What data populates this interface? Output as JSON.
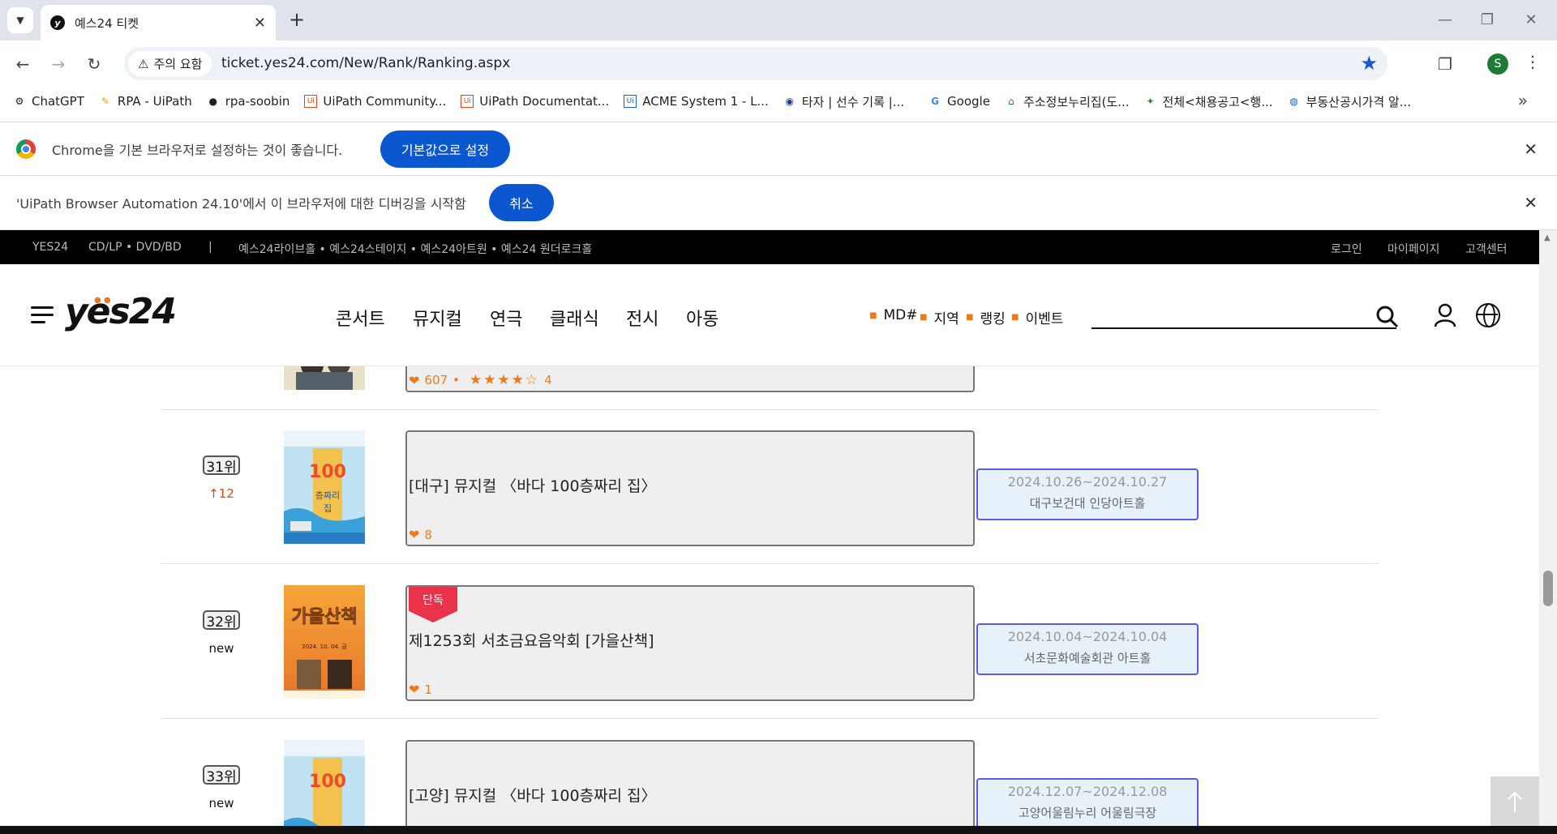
{
  "browser": {
    "tab_title": "예스24 티켓",
    "tab_favicon": "y",
    "security_chip": "주의 요함",
    "url": "ticket.yes24.com/New/Rank/Ranking.aspx",
    "profile_initial": "S",
    "bookmarks": [
      {
        "label": "ChatGPT",
        "icon": "chatgpt-icon"
      },
      {
        "label": "RPA - UiPath",
        "icon": "pencil-icon"
      },
      {
        "label": "rpa-soobin",
        "icon": "github-icon"
      },
      {
        "label": "UiPath Community...",
        "icon": "uipath-icon"
      },
      {
        "label": "UiPath Documentat...",
        "icon": "uipath-icon"
      },
      {
        "label": "ACME System 1 - L...",
        "icon": "ui-icon"
      },
      {
        "label": "타자 | 선수 기록 |...",
        "icon": "baseball-icon"
      },
      {
        "label": "Google",
        "icon": "google-icon"
      },
      {
        "label": "주소정보누리집(도...",
        "icon": "home-icon"
      },
      {
        "label": "전체<채용공고<행...",
        "icon": "bird-icon"
      },
      {
        "label": "부동산공시가격 알...",
        "icon": "globe-icon"
      }
    ],
    "infobar_default": {
      "message": "Chrome을 기본 브라우저로 설정하는 것이 좋습니다.",
      "button": "기본값으로 설정"
    },
    "infobar_debug": {
      "message": "'UiPath Browser Automation 24.10'에서 이 브라우저에 대한 디버깅을 시작함",
      "button": "취소"
    }
  },
  "site": {
    "topbar": {
      "left": [
        "YES24",
        "CD/LP • DVD/BD",
        "|",
        "예스24라이브홀 • 예스24스테이지 • 예스24아트원 • 예스24 원더로크홀"
      ],
      "right": [
        "로그인",
        "마이페이지",
        "고객센터"
      ]
    },
    "logo": "yes24",
    "main_nav": [
      "콘서트",
      "뮤지컬",
      "연극",
      "클래식",
      "전시",
      "아동"
    ],
    "sub_nav": [
      "MD#",
      "지역",
      "랭킹",
      "이벤트"
    ],
    "search_placeholder": ""
  },
  "rankings": [
    {
      "likes": "607",
      "rating": "4",
      "stars_filled": 4
    },
    {
      "rank": "31위",
      "change": "↑12",
      "title": "[대구] 뮤지컬 〈바다 100층짜리 집〉",
      "likes": "8",
      "dates": "2024.10.26~2024.10.27",
      "venue": "대구보건대 인당아트홀"
    },
    {
      "rank": "32위",
      "change": "new",
      "badge": "단독",
      "title": "제1253회 서초금요음악회 [가을산책]",
      "likes": "1",
      "dates": "2024.10.04~2024.10.04",
      "venue": "서초문화예술회관 아트홀"
    },
    {
      "rank": "33위",
      "change": "new",
      "title": "[고양] 뮤지컬 〈바다 100층짜리 집〉",
      "dates": "2024.12.07~2024.12.08",
      "venue": "고양어울림누리 어울림극장"
    }
  ],
  "posters": {
    "poster_100_text": "100",
    "poster_autumn_text": "가을산책",
    "poster_autumn_date": "2024. 10. 04. 금"
  },
  "colors": {
    "accent_orange": "#f07a1a",
    "exclusive_red": "#e8334a",
    "chrome_blue": "#0b57d0"
  }
}
